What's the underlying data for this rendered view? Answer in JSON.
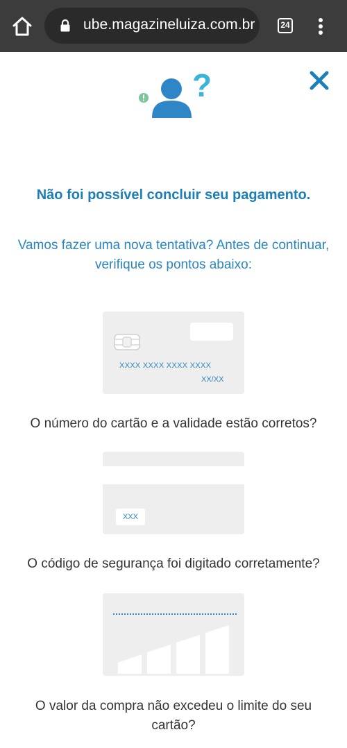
{
  "browser": {
    "url": "ube.magazineluiza.com.br",
    "tab_count": "24",
    "icons": [
      "home-icon",
      "lock-icon",
      "tab-switcher-icon",
      "more-vert-icon"
    ]
  },
  "colors": {
    "accent": "#1d7fb9",
    "text": "#333333",
    "panel": "#eeeeee",
    "alert_dot": "#7cc49a"
  },
  "content": {
    "title": "Não foi possível concluir seu pagamento.",
    "subtitle_line1": "Vamos fazer uma nova tentativa? Antes de continuar,",
    "subtitle_line2": "verifique os pontos abaixo:",
    "card_front": {
      "number": "XXXX XXXX XXXX XXXX",
      "expiry": "XX/XX",
      "caption": "O número do cartão e a validade estão corretos?"
    },
    "card_back": {
      "cvv": "XXX",
      "caption": "O código de segurança foi digitado corretamente?"
    },
    "limit": {
      "caption_line1": "O valor da compra não excedeu o limite do seu",
      "caption_line2": "cartão?"
    },
    "icons": [
      "close-icon",
      "user-question-icon",
      "alert-icon",
      "chip-icon"
    ]
  }
}
